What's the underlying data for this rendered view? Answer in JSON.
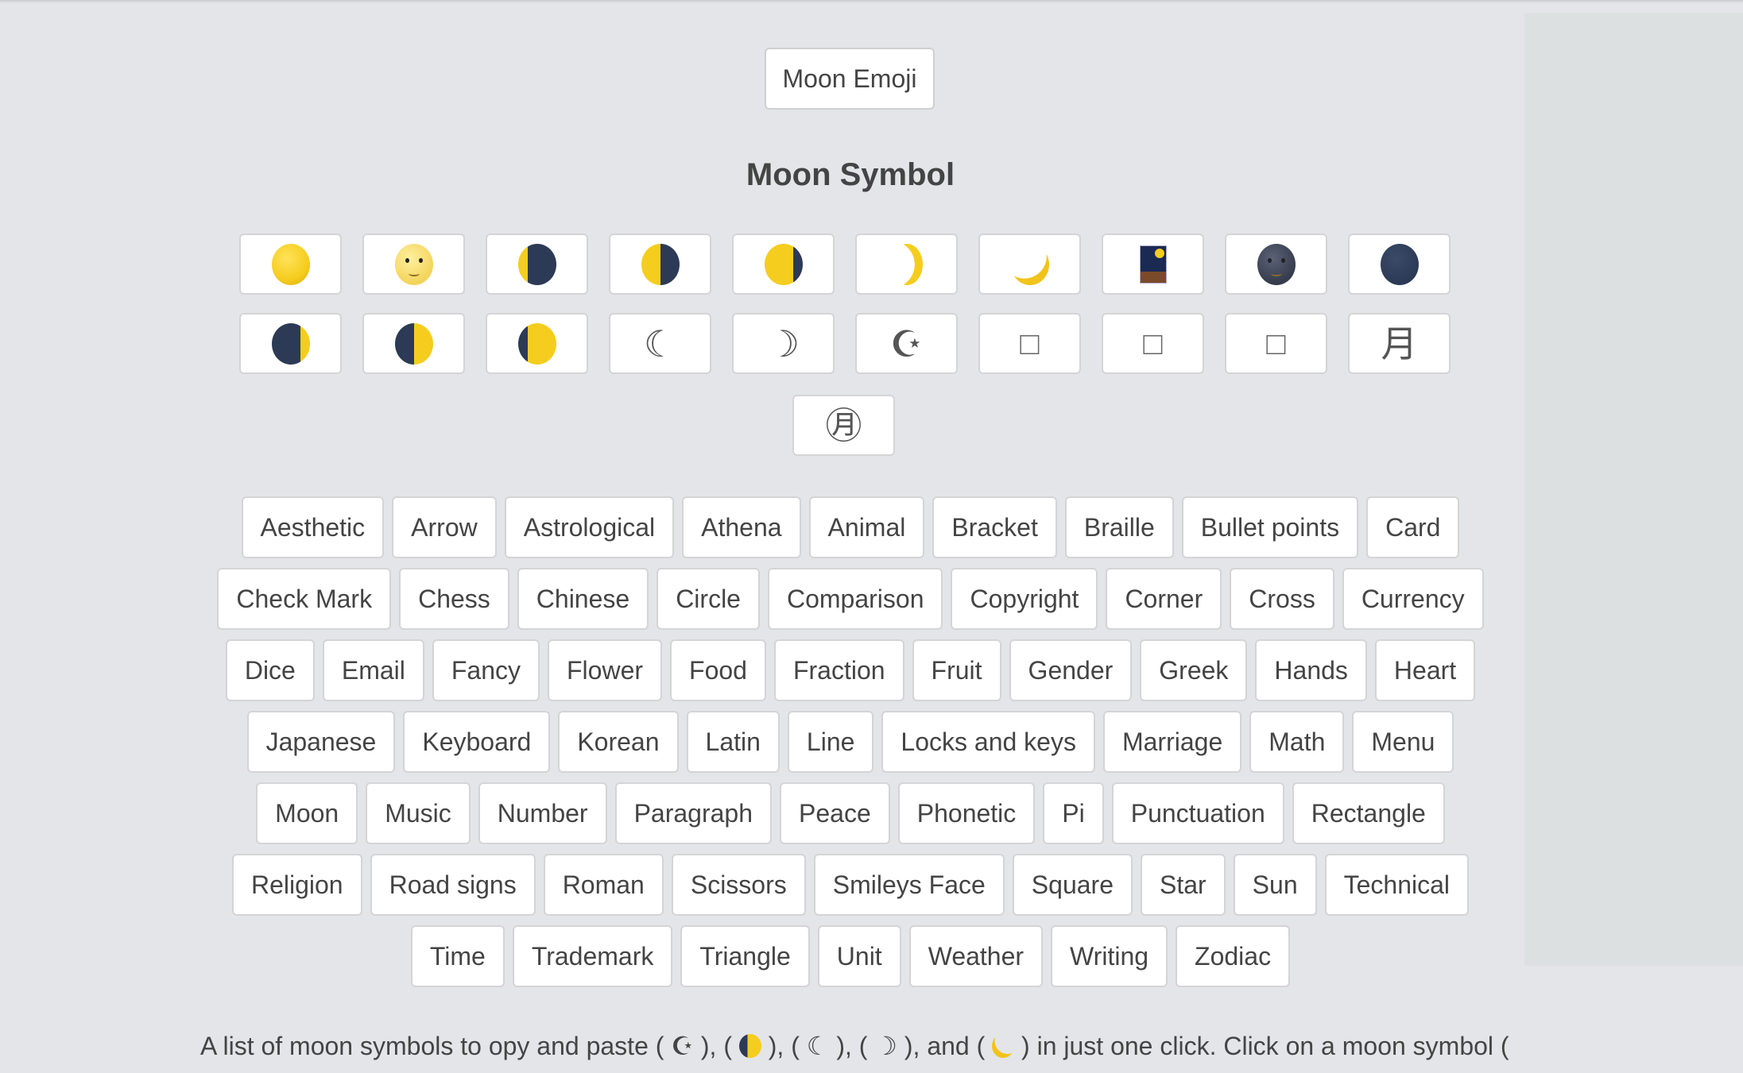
{
  "header": {
    "emoji_button_label": "Moon Emoji",
    "title": "Moon Symbol"
  },
  "symbols": [
    {
      "char": "🌕",
      "icon": "full-moon-icon"
    },
    {
      "char": "🌝",
      "icon": "full-moon-face-icon"
    },
    {
      "char": "🌘",
      "icon": "waning-crescent-moon-icon"
    },
    {
      "char": "🌗",
      "icon": "last-quarter-moon-icon"
    },
    {
      "char": "🌖",
      "icon": "waning-gibbous-moon-icon"
    },
    {
      "char": "🌛",
      "icon": "first-quarter-moon-face-icon"
    },
    {
      "char": "🌙",
      "icon": "crescent-moon-icon"
    },
    {
      "char": "🎑",
      "icon": "moon-viewing-ceremony-icon"
    },
    {
      "char": "🌚",
      "icon": "new-moon-face-icon"
    },
    {
      "char": "🌑",
      "icon": "new-moon-icon"
    },
    {
      "char": "🌒",
      "icon": "waxing-crescent-moon-icon"
    },
    {
      "char": "🌓",
      "icon": "first-quarter-moon-icon"
    },
    {
      "char": "🌔",
      "icon": "waxing-gibbous-moon-icon"
    },
    {
      "char": "☾",
      "icon": "last-quarter-crescent-icon"
    },
    {
      "char": "☽",
      "icon": "first-quarter-crescent-icon"
    },
    {
      "char": "☪",
      "icon": "star-and-crescent-icon"
    },
    {
      "char": "□",
      "icon": "missing-glyph-icon"
    },
    {
      "char": "□",
      "icon": "missing-glyph-icon"
    },
    {
      "char": "□",
      "icon": "missing-glyph-icon"
    },
    {
      "char": "月",
      "icon": "cjk-moon-icon"
    },
    {
      "char": "㊊",
      "icon": "circled-moon-ideograph-icon"
    }
  ],
  "tag_rows": [
    [
      "Aesthetic",
      "Arrow",
      "Astrological",
      "Athena",
      "Animal",
      "Bracket",
      "Braille",
      "Bullet points",
      "Card"
    ],
    [
      "Check Mark",
      "Chess",
      "Chinese",
      "Circle",
      "Comparison",
      "Copyright",
      "Corner",
      "Cross",
      "Currency"
    ],
    [
      "Dice",
      "Email",
      "Fancy",
      "Flower",
      "Food",
      "Fraction",
      "Fruit",
      "Gender",
      "Greek",
      "Hands",
      "Heart"
    ],
    [
      "Japanese",
      "Keyboard",
      "Korean",
      "Latin",
      "Line",
      "Locks and keys",
      "Marriage",
      "Math",
      "Menu"
    ],
    [
      "Moon",
      "Music",
      "Number",
      "Paragraph",
      "Peace",
      "Phonetic",
      "Pi",
      "Punctuation",
      "Rectangle"
    ],
    [
      "Religion",
      "Road signs",
      "Roman",
      "Scissors",
      "Smileys Face",
      "Square",
      "Star",
      "Sun",
      "Technical"
    ],
    [
      "Time",
      "Trademark",
      "Triangle",
      "Unit",
      "Weather",
      "Writing",
      "Zodiac"
    ]
  ],
  "description": {
    "part1": "A list of moon symbols to opy and paste ( ",
    "sym1": "☪",
    "part2": " ), ( ",
    "part3": " ), ( ",
    "sym3": "☾",
    "part4": " ), ( ",
    "sym4": "☽",
    "part5": " ), and ( ",
    "part6": " ) in just one click. Click on a moon symbol ("
  },
  "colors": {
    "background": "#e4e5e8",
    "side_panel": "#dde0e0",
    "text": "#444444",
    "card_border": "#d4d4d6",
    "moon_yellow": "#f5cd1e",
    "moon_dark": "#2c3a55"
  }
}
